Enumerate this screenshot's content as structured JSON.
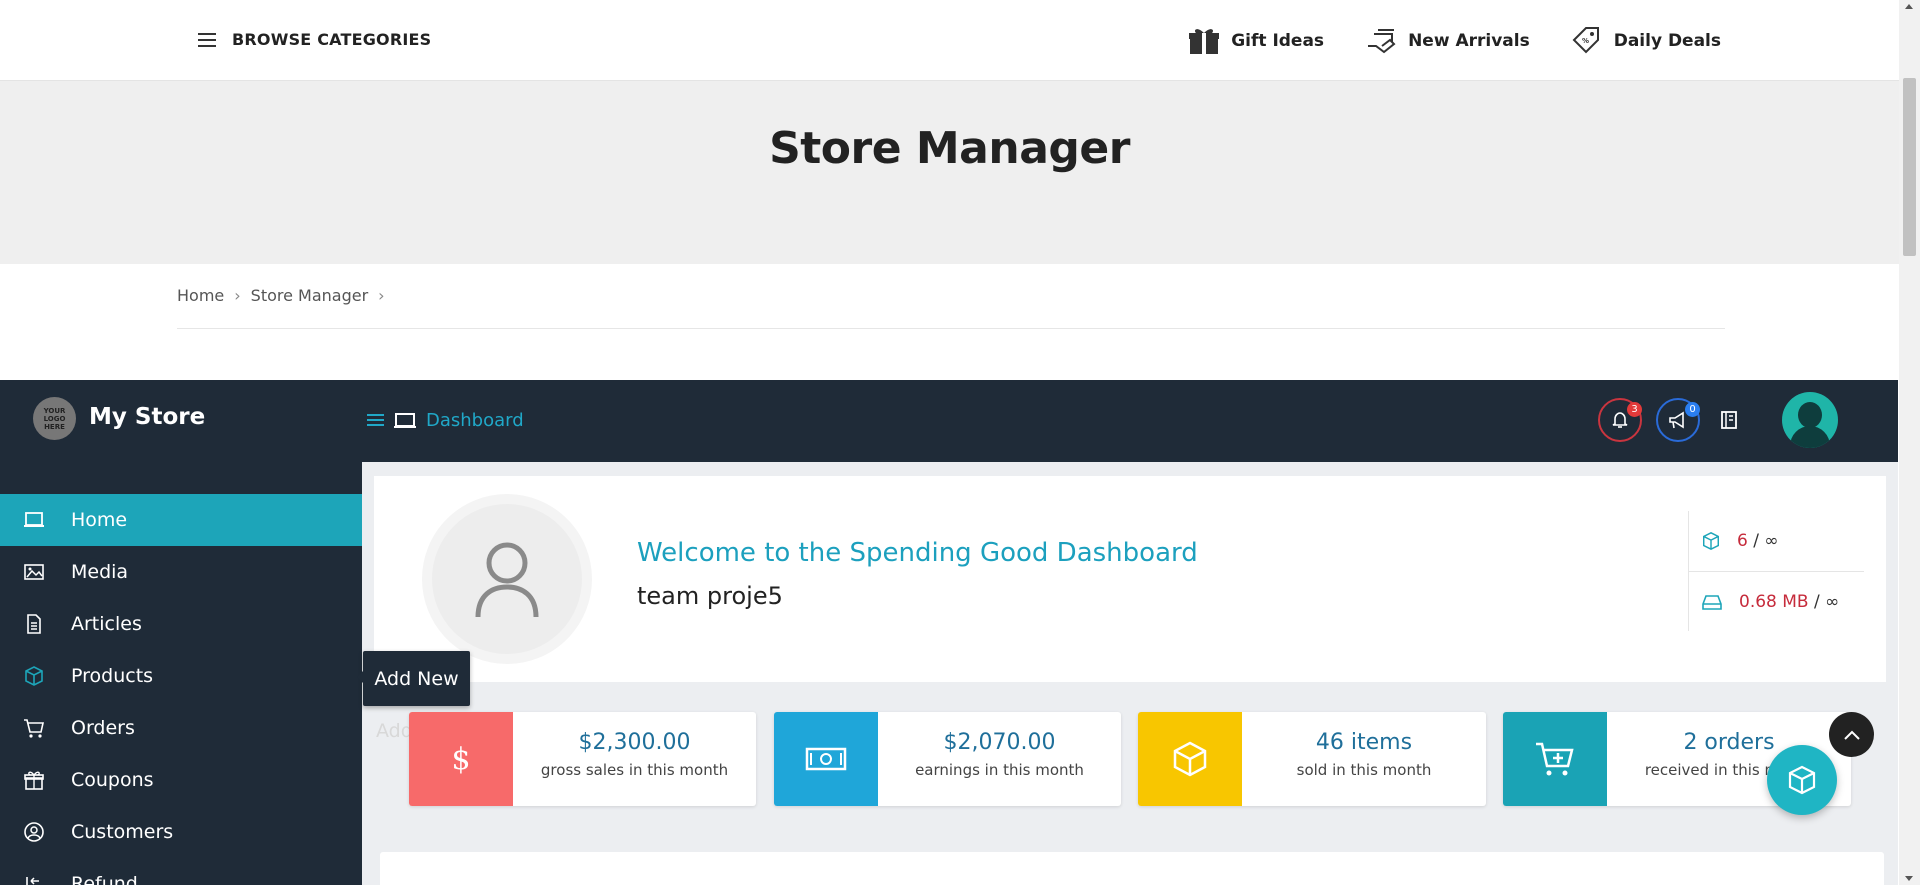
{
  "topbar": {
    "browse_label": "BROWSE CATEGORIES",
    "nav": [
      {
        "label": "Gift Ideas",
        "icon": "gift-icon"
      },
      {
        "label": "New Arrivals",
        "icon": "new-arrivals-icon"
      },
      {
        "label": "Daily Deals",
        "icon": "price-tag-icon"
      }
    ]
  },
  "page": {
    "title": "Store Manager",
    "breadcrumb": [
      "Home",
      "Store Manager"
    ]
  },
  "dashboard": {
    "logo_text": "YOUR LOGO HERE",
    "store_name": "My Store",
    "crumb": "Dashboard",
    "notifications_count": "3",
    "announcements_count": "0"
  },
  "sidebar": {
    "items": [
      {
        "label": "Home",
        "icon": "monitor-icon",
        "active": true
      },
      {
        "label": "Media",
        "icon": "image-icon"
      },
      {
        "label": "Articles",
        "icon": "document-icon"
      },
      {
        "label": "Products",
        "icon": "cube-icon"
      },
      {
        "label": "Orders",
        "icon": "cart-icon"
      },
      {
        "label": "Coupons",
        "icon": "gift-icon"
      },
      {
        "label": "Customers",
        "icon": "user-circle-icon"
      },
      {
        "label": "Refund",
        "icon": "refund-icon"
      }
    ]
  },
  "tooltip": "Add New",
  "welcome": {
    "title": "Welcome to the Spending Good Dashboard",
    "user": "team proje5"
  },
  "quota": {
    "products_used": "6",
    "products_limit": "∞",
    "storage_used": "0.68 MB",
    "storage_limit": "∞",
    "separator": "/"
  },
  "stats": [
    {
      "value": "$2,300.00",
      "label": "gross sales in this month",
      "color": "#f76a6a",
      "icon": "dollar-icon"
    },
    {
      "value": "$2,070.00",
      "label": "earnings in this month",
      "color": "#1fa6d9",
      "icon": "banknote-icon"
    },
    {
      "value": "46 items",
      "label": "sold in this month",
      "color": "#f8c600",
      "icon": "cube-icon"
    },
    {
      "value": "2 orders",
      "label": "received in this month",
      "color": "#1aa3b5",
      "icon": "cart-plus-icon"
    }
  ],
  "colors": {
    "accent": "#1da5b9",
    "dark": "#1f2b38"
  }
}
